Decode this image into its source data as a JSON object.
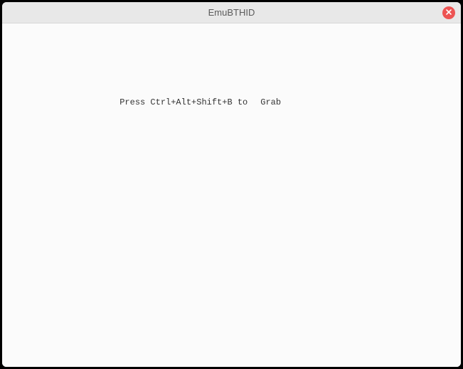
{
  "window": {
    "title": "EmuBTHID"
  },
  "content": {
    "hint_prefix": "Press Ctrl+Alt+Shift+B to",
    "hint_action": "Grab"
  },
  "icons": {
    "close": "close-icon"
  }
}
